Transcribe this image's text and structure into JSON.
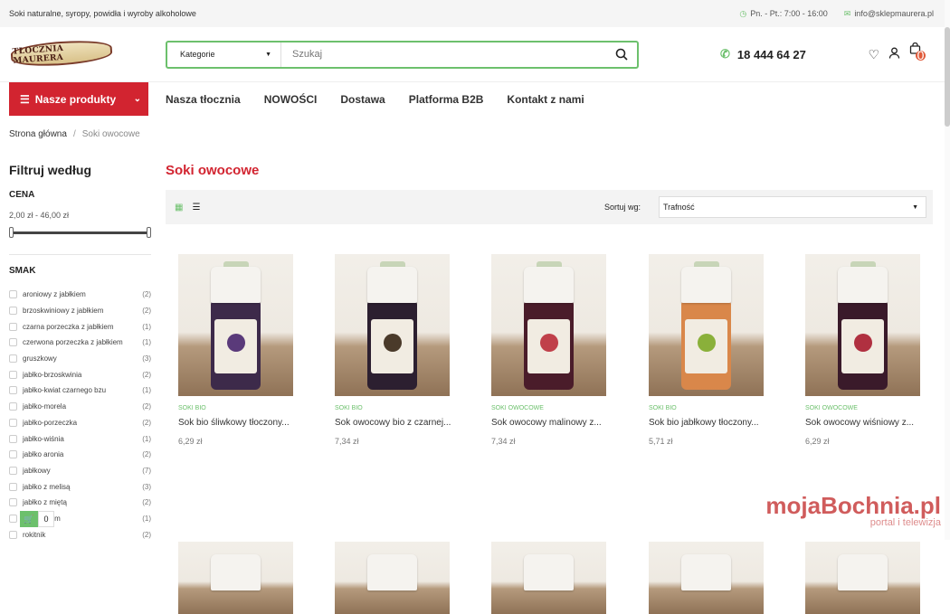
{
  "topbar": {
    "tagline": "Soki naturalne, syropy, powidła i wyroby alkoholowe",
    "hours": "Pn. - Pt.: 7:00 - 16:00",
    "email": "info@sklepmaurera.pl"
  },
  "header": {
    "logo_text": "TŁOCZNIA MAURERA",
    "category_label": "Kategorie",
    "search_placeholder": "Szukaj",
    "phone": "18 444 64 27",
    "cart_count": "0"
  },
  "nav": {
    "products_button": "Nasze produkty",
    "links": [
      "Nasza tłocznia",
      "NOWOŚCI",
      "Dostawa",
      "Platforma B2B",
      "Kontakt z nami"
    ]
  },
  "breadcrumb": {
    "home": "Strona główna",
    "sep": "/",
    "current": "Soki owocowe"
  },
  "sidebar": {
    "title": "Filtruj według",
    "price_heading": "CENA",
    "price_range": "2,00 zł - 46,00 zł",
    "taste_heading": "SMAK",
    "filters": [
      {
        "label": "aroniowy z jabłkiem",
        "count": "(2)"
      },
      {
        "label": "brzoskwiniowy z jabłkiem",
        "count": "(2)"
      },
      {
        "label": "czarna porzeczka z jabłkiem",
        "count": "(1)"
      },
      {
        "label": "czerwona porzeczka z jabłkiem",
        "count": "(1)"
      },
      {
        "label": "gruszkowy",
        "count": "(3)"
      },
      {
        "label": "jabłko-brzoskwinia",
        "count": "(2)"
      },
      {
        "label": "jabłko-kwiat czarnego bzu",
        "count": "(1)"
      },
      {
        "label": "jabłko-morela",
        "count": "(2)"
      },
      {
        "label": "jabłko-porzeczka",
        "count": "(2)"
      },
      {
        "label": "jabłko-wiśnia",
        "count": "(1)"
      },
      {
        "label": "jabłko aronia",
        "count": "(2)"
      },
      {
        "label": "jabłkowy",
        "count": "(7)"
      },
      {
        "label": "jabłko z melisą",
        "count": "(3)"
      },
      {
        "label": "jabłko z miętą",
        "count": "(2)"
      },
      {
        "label": "y z jabłkiem",
        "count": "(1)"
      },
      {
        "label": "rokitnik",
        "count": "(2)"
      }
    ]
  },
  "main": {
    "title": "Soki owocowe",
    "sort_label": "Sortuj wg:",
    "sort_value": "Trafność",
    "products": [
      {
        "category": "SOKI BIO",
        "name": "Sok bio śliwkowy tłoczony...",
        "price": "6,29 zł",
        "body_color": "#3d2a4a",
        "fruit_color": "#5a3a7a"
      },
      {
        "category": "SOKI BIO",
        "name": "Sok owocowy bio z czarnej...",
        "price": "7,34 zł",
        "body_color": "#2c1f30",
        "fruit_color": "#4a3a2a"
      },
      {
        "category": "SOKI OWOCOWE",
        "name": "Sok owocowy malinowy z...",
        "price": "7,34 zł",
        "body_color": "#4a1c2a",
        "fruit_color": "#c0404a"
      },
      {
        "category": "SOKI BIO",
        "name": "Sok bio jabłkowy tłoczony...",
        "price": "5,71 zł",
        "body_color": "#d9874a",
        "fruit_color": "#8ab03a"
      },
      {
        "category": "SOKI OWOCOWE",
        "name": "Sok owocowy wiśniowy z...",
        "price": "6,29 zł",
        "body_color": "#3a1a2a",
        "fruit_color": "#b03040"
      }
    ]
  },
  "floating_cart_count": "0",
  "watermark": {
    "brand": "mojaBochnia.pl",
    "sub": "portal i telewizja"
  }
}
